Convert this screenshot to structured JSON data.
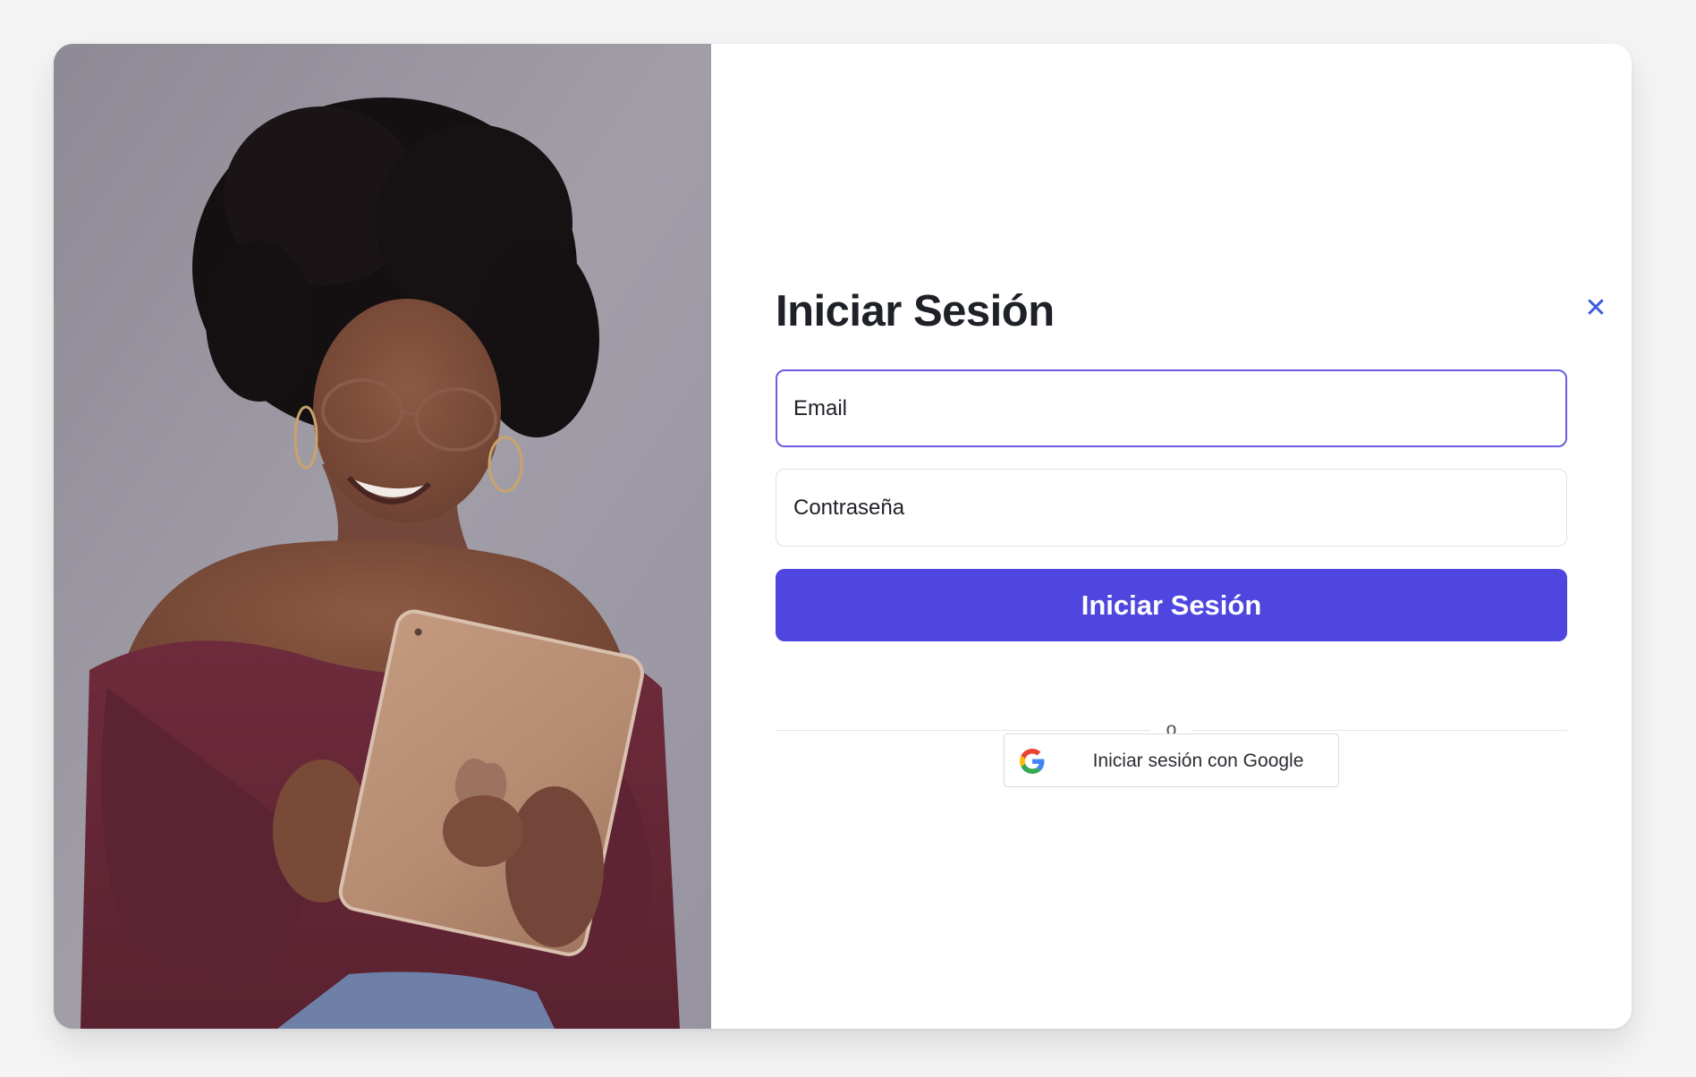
{
  "login": {
    "title": "Iniciar Sesión",
    "close_icon": "close-icon",
    "email": {
      "placeholder": "Email",
      "value": ""
    },
    "password": {
      "placeholder": "Contraseña",
      "value": ""
    },
    "submit_label": "Iniciar Sesión",
    "divider_text": "o",
    "google": {
      "label": "Iniciar sesión con Google",
      "icon": "google-icon"
    }
  },
  "theme": {
    "primary": "#4f46e0",
    "focus_border": "#6b5ee0",
    "close_icon_color": "#3b5bdb",
    "title_color": "#1f2128"
  },
  "photo": {
    "subject": "hero-photo",
    "icon": "woman-with-tablet-image"
  }
}
